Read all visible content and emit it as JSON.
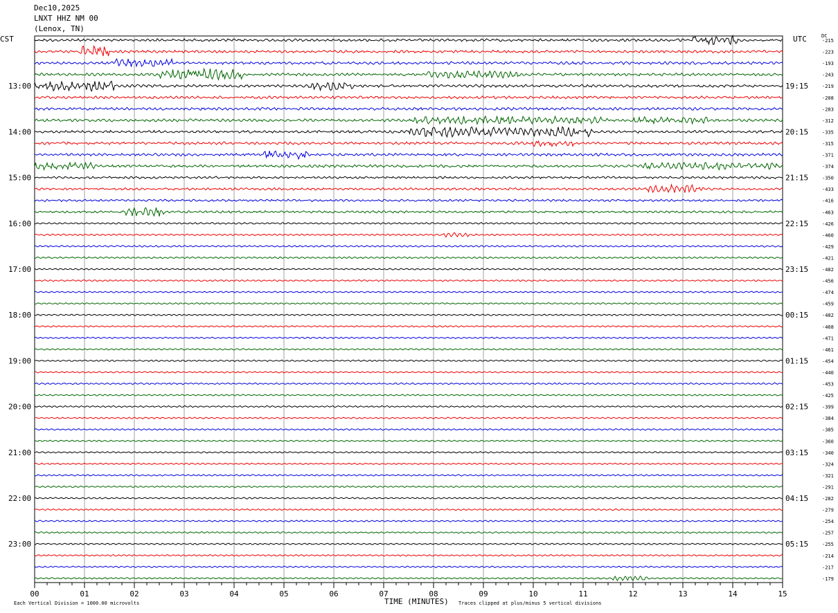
{
  "header": {
    "date": "Dec10,2025",
    "station": "LNXT HHZ NM 00",
    "location": "(Lenox, TN)"
  },
  "left_zone_label": "CST",
  "right_zone_label": "UTC",
  "dc_label": "DC",
  "footer": {
    "xlabel": "TIME (MINUTES)",
    "scale_note": "Each Vertical Division = 1000.00 microvolts",
    "clip_note": "Traces clipped at plus/minus 5 vertical divisions"
  },
  "colors": {
    "cycle": [
      "#000000",
      "#ee0000",
      "#0000dd",
      "#006600"
    ],
    "grid": "#888888"
  },
  "chart_data": {
    "type": "line",
    "title": "",
    "xlabel": "TIME (MINUTES)",
    "ylabel": "",
    "xlim": [
      0,
      15
    ],
    "x_ticks": [
      "00",
      "01",
      "02",
      "03",
      "04",
      "05",
      "06",
      "07",
      "08",
      "09",
      "10",
      "11",
      "12",
      "13",
      "14",
      "15"
    ],
    "left_hour_labels": [
      "13:00",
      "14:00",
      "15:00",
      "16:00",
      "17:00",
      "18:00",
      "19:00",
      "20:00",
      "21:00",
      "22:00",
      "23:00"
    ],
    "right_hour_labels": [
      "19:15",
      "20:15",
      "21:15",
      "22:15",
      "23:15",
      "00:15",
      "01:15",
      "02:15",
      "03:15",
      "04:15",
      "05:15"
    ],
    "dc_offsets": [
      215,
      223,
      193,
      243,
      219,
      208,
      283,
      312,
      335,
      315,
      371,
      374,
      350,
      433,
      416,
      463,
      426,
      460,
      429,
      421,
      482,
      456,
      474,
      459,
      482,
      468,
      471,
      461,
      454,
      440,
      453,
      425,
      399,
      384,
      385,
      360,
      340,
      324,
      321,
      291,
      282,
      279,
      254,
      257,
      255,
      214,
      217,
      179
    ],
    "trace_count": 48,
    "noisy_segments": [
      {
        "trace": 0,
        "start": 13.2,
        "end": 14.1,
        "amp": 2.0
      },
      {
        "trace": 1,
        "start": 0.9,
        "end": 1.5,
        "amp": 2.5
      },
      {
        "trace": 2,
        "start": 1.6,
        "end": 2.8,
        "amp": 1.8
      },
      {
        "trace": 3,
        "start": 2.5,
        "end": 4.2,
        "amp": 2.6
      },
      {
        "trace": 3,
        "start": 7.8,
        "end": 9.8,
        "amp": 1.6
      },
      {
        "trace": 4,
        "start": 0.0,
        "end": 1.6,
        "amp": 2.2
      },
      {
        "trace": 4,
        "start": 5.5,
        "end": 6.4,
        "amp": 2.0
      },
      {
        "trace": 7,
        "start": 7.6,
        "end": 11.5,
        "amp": 1.7
      },
      {
        "trace": 7,
        "start": 12.0,
        "end": 13.5,
        "amp": 1.5
      },
      {
        "trace": 8,
        "start": 7.5,
        "end": 11.2,
        "amp": 2.2
      },
      {
        "trace": 9,
        "start": 10.0,
        "end": 10.8,
        "amp": 1.5
      },
      {
        "trace": 10,
        "start": 4.6,
        "end": 5.5,
        "amp": 2.0
      },
      {
        "trace": 11,
        "start": 0.0,
        "end": 1.2,
        "amp": 1.6
      },
      {
        "trace": 11,
        "start": 12.2,
        "end": 15.0,
        "amp": 1.6
      },
      {
        "trace": 13,
        "start": 12.3,
        "end": 13.4,
        "amp": 2.0
      },
      {
        "trace": 15,
        "start": 1.8,
        "end": 2.6,
        "amp": 2.2
      },
      {
        "trace": 17,
        "start": 8.2,
        "end": 8.7,
        "amp": 1.4
      },
      {
        "trace": 47,
        "start": 11.6,
        "end": 12.3,
        "amp": 1.6
      }
    ]
  }
}
